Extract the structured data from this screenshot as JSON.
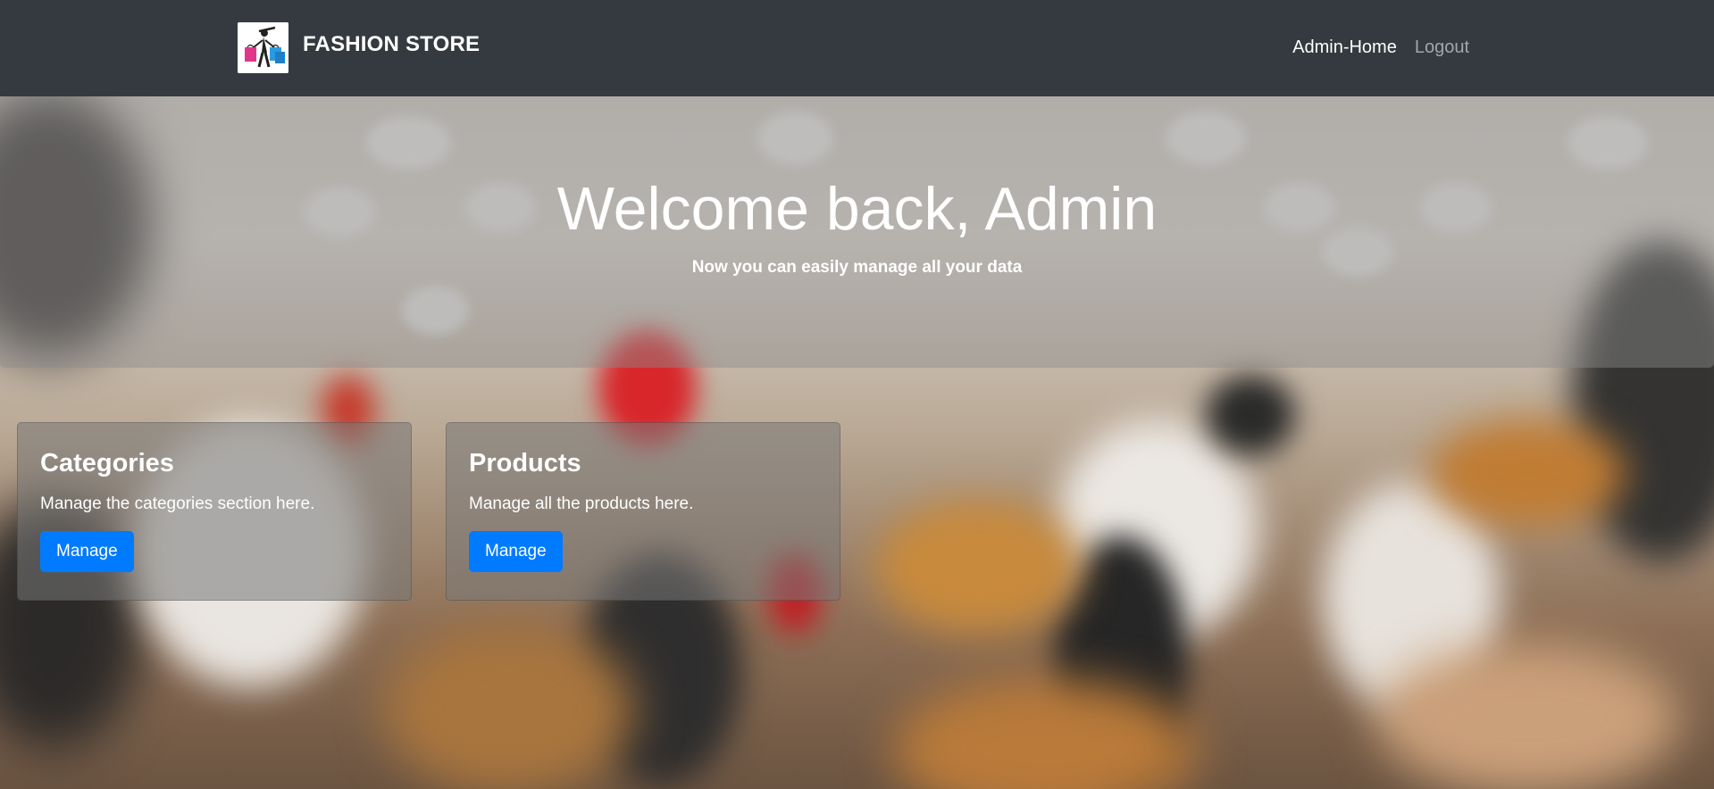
{
  "brand": {
    "name": "FASHION STORE",
    "logo_icon": "shopper-with-bags-icon"
  },
  "nav": {
    "links": [
      {
        "label": "Admin-Home",
        "active": true
      },
      {
        "label": "Logout",
        "active": false
      }
    ]
  },
  "hero": {
    "title": "Welcome back, Admin",
    "subtitle": "Now you can easily manage all your data"
  },
  "cards": [
    {
      "title": "Categories",
      "text": "Manage the categories section here.",
      "button": "Manage"
    },
    {
      "title": "Products",
      "text": "Manage all the products here.",
      "button": "Manage"
    }
  ],
  "colors": {
    "navbar": "#343a40",
    "primary_button": "#007bff"
  }
}
